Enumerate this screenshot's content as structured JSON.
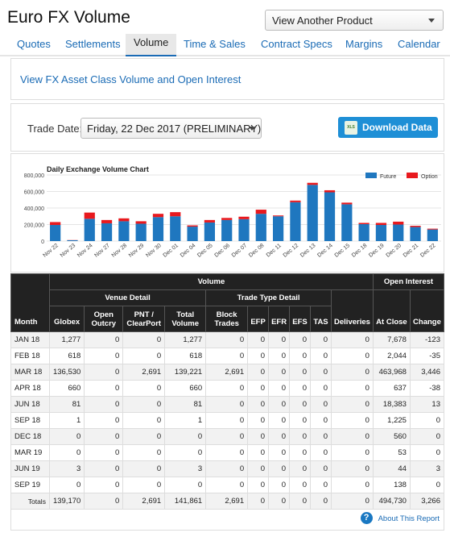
{
  "page_title": "Euro FX Volume",
  "product_select": "View Another Product",
  "tabs": [
    "Quotes",
    "Settlements",
    "Volume",
    "Time & Sales",
    "Contract Specs",
    "Margins",
    "Calendar"
  ],
  "asset_link": "View FX Asset Class Volume and Open Interest",
  "trade_date_label": "Trade Date:",
  "trade_date_value": "Friday, 22 Dec 2017 (PRELIMINARY)",
  "download_label": "Download Data",
  "xls_label": "XLS",
  "colors": {
    "future": "#1f77bf",
    "option": "#e8191e",
    "link": "#1a6bb5",
    "header_bg": "#222222"
  },
  "chart_data": {
    "type": "bar",
    "title": "Daily Exchange Volume Chart",
    "stacked": true,
    "legend_position": "top-right",
    "categories": [
      "Nov 22",
      "Nov 23",
      "Nov 24",
      "Nov 27",
      "Nov 28",
      "Nov 29",
      "Nov 30",
      "Dec 01",
      "Dec 04",
      "Dec 05",
      "Dec 06",
      "Dec 07",
      "Dec 08",
      "Dec 11",
      "Dec 12",
      "Dec 13",
      "Dec 14",
      "Dec 15",
      "Dec 18",
      "Dec 19",
      "Dec 20",
      "Dec 21",
      "Dec 22"
    ],
    "yticks": [
      "0",
      "200,000",
      "400,000",
      "600,000",
      "800,000"
    ],
    "ylim": [
      0,
      800000
    ],
    "series": [
      {
        "name": "Future",
        "values": [
          195000,
          10000,
          270000,
          215000,
          240000,
          210000,
          290000,
          300000,
          175000,
          225000,
          255000,
          265000,
          330000,
          300000,
          470000,
          680000,
          590000,
          445000,
          205000,
          195000,
          200000,
          170000,
          140000
        ]
      },
      {
        "name": "Option",
        "values": [
          35000,
          2000,
          75000,
          40000,
          35000,
          30000,
          40000,
          50000,
          15000,
          30000,
          25000,
          30000,
          50000,
          10000,
          20000,
          25000,
          25000,
          20000,
          15000,
          25000,
          35000,
          15000,
          10000
        ]
      }
    ]
  },
  "table": {
    "group_volume": "Volume",
    "group_oi": "Open Interest",
    "group_venue": "Venue Detail",
    "group_trade": "Trade Type Detail",
    "col_month": "Month",
    "col_globex": "Globex",
    "col_open_outcry": "Open Outcry",
    "col_pnt": "PNT / ClearPort",
    "col_total": "Total Volume",
    "col_block": "Block Trades",
    "col_efp": "EFP",
    "col_efr": "EFR",
    "col_efs": "EFS",
    "col_tas": "TAS",
    "col_deliveries": "Deliveries",
    "col_at_close": "At Close",
    "col_change": "Change",
    "rows": [
      [
        "JAN 18",
        "1,277",
        "0",
        "0",
        "1,277",
        "0",
        "0",
        "0",
        "0",
        "0",
        "0",
        "7,678",
        "-123"
      ],
      [
        "FEB 18",
        "618",
        "0",
        "0",
        "618",
        "0",
        "0",
        "0",
        "0",
        "0",
        "0",
        "2,044",
        "-35"
      ],
      [
        "MAR 18",
        "136,530",
        "0",
        "2,691",
        "139,221",
        "2,691",
        "0",
        "0",
        "0",
        "0",
        "0",
        "463,968",
        "3,446"
      ],
      [
        "APR 18",
        "660",
        "0",
        "0",
        "660",
        "0",
        "0",
        "0",
        "0",
        "0",
        "0",
        "637",
        "-38"
      ],
      [
        "JUN 18",
        "81",
        "0",
        "0",
        "81",
        "0",
        "0",
        "0",
        "0",
        "0",
        "0",
        "18,383",
        "13"
      ],
      [
        "SEP 18",
        "1",
        "0",
        "0",
        "1",
        "0",
        "0",
        "0",
        "0",
        "0",
        "0",
        "1,225",
        "0"
      ],
      [
        "DEC 18",
        "0",
        "0",
        "0",
        "0",
        "0",
        "0",
        "0",
        "0",
        "0",
        "0",
        "560",
        "0"
      ],
      [
        "MAR 19",
        "0",
        "0",
        "0",
        "0",
        "0",
        "0",
        "0",
        "0",
        "0",
        "0",
        "53",
        "0"
      ],
      [
        "JUN 19",
        "3",
        "0",
        "0",
        "3",
        "0",
        "0",
        "0",
        "0",
        "0",
        "0",
        "44",
        "3"
      ],
      [
        "SEP 19",
        "0",
        "0",
        "0",
        "0",
        "0",
        "0",
        "0",
        "0",
        "0",
        "0",
        "138",
        "0"
      ],
      [
        "Totals",
        "139,170",
        "0",
        "2,691",
        "141,861",
        "2,691",
        "0",
        "0",
        "0",
        "0",
        "0",
        "494,730",
        "3,266"
      ]
    ]
  },
  "about_link": "About This Report",
  "help_glyph": "?"
}
